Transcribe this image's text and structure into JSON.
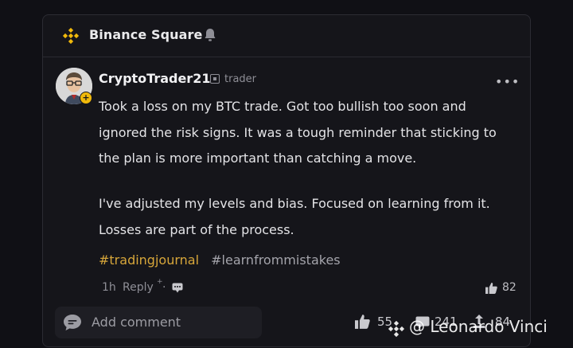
{
  "header": {
    "brand": "Binance Square",
    "brand_color": "#f0b90b"
  },
  "post": {
    "author": "CryptoTrader21",
    "role": "trader",
    "avatar_badge": "+",
    "more_label": "•••",
    "paragraph1_lines": [
      "Took a loss on my BTC trade. Got too bullish too soon and",
      "ignored the risk signs. It was a tough reminder that sticking to",
      "the plan is more important than catching a move."
    ],
    "paragraph2_lines": [
      "I've adjusted my levels and bias. Focused on learning from it.",
      "Losses are part of the process."
    ],
    "tags": [
      "#tradingjournal",
      "#learnfrommistakes"
    ],
    "time": "1h",
    "reply_label": "Reply",
    "reply_sup": "+",
    "reply_dot": "·",
    "likes": "82"
  },
  "footer": {
    "add_comment_placeholder": "Add comment",
    "stats": {
      "likes": "55",
      "comments": "241",
      "shares": "84"
    }
  },
  "watermark": "@ Leonardo Vinci",
  "colors": {
    "accent": "#f0b90b",
    "tag": "#d7a63a",
    "background": "#101015",
    "card": "#15151a"
  }
}
